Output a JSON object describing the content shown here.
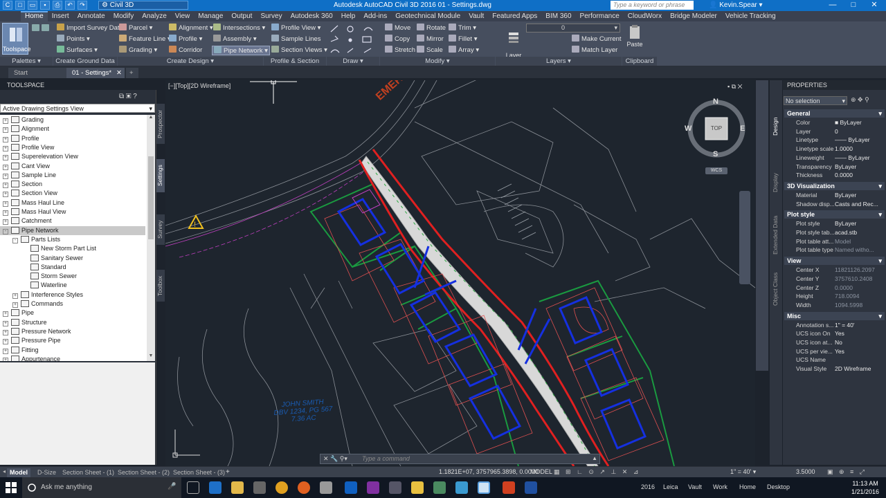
{
  "titlebar": {
    "workspace": "Civil 3D",
    "title": "Autodesk AutoCAD Civil 3D 2016   01 - Settings.dwg",
    "search_placeholder": "Type a keyword or phrase",
    "user": "Kevin.Spear"
  },
  "tabs": [
    "Home",
    "Insert",
    "Annotate",
    "Modify",
    "Analyze",
    "View",
    "Manage",
    "Output",
    "Survey",
    "Autodesk 360",
    "Help",
    "Add-ins",
    "Geotechnical Module",
    "Vault",
    "Featured Apps",
    "BIM 360",
    "Performance",
    "CloudWorx",
    "Bridge Modeler",
    "Vehicle Tracking"
  ],
  "ribbon": {
    "toolspace": "Toolspace",
    "import_survey": "Import Survey Data",
    "points": "Points",
    "surfaces": "Surfaces",
    "parcel": "Parcel",
    "feature_line": "Feature Line",
    "grading": "Grading",
    "alignment": "Alignment",
    "profile": "Profile",
    "corridor": "Corridor",
    "intersections": "Intersections",
    "assembly": "Assembly",
    "pipe_network": "Pipe Network",
    "profile_view": "Profile View",
    "sample_lines": "Sample Lines",
    "section_views": "Section Views",
    "move": "Move",
    "copy": "Copy",
    "stretch": "Stretch",
    "rotate": "Rotate",
    "mirror": "Mirror",
    "scale": "Scale",
    "trim": "Trim",
    "fillet": "Fillet",
    "array": "Array",
    "layer_properties": "Layer\nProperties",
    "layer_value": "0",
    "make_current": "Make Current",
    "match_layer": "Match Layer",
    "paste": "Paste",
    "panels": [
      "Palettes",
      "Create Ground Data",
      "Create Design",
      "Profile & Section Views",
      "Draw",
      "Modify",
      "Layers",
      "Clipboard"
    ]
  },
  "doctabs": [
    "Start",
    "01 - Settings*"
  ],
  "toolspace": {
    "title": "TOOLSPACE",
    "view": "Active Drawing Settings View",
    "tree": [
      {
        "label": "Grading",
        "level": 0,
        "exp": "+"
      },
      {
        "label": "Alignment",
        "level": 0,
        "exp": "+"
      },
      {
        "label": "Profile",
        "level": 0,
        "exp": "+"
      },
      {
        "label": "Profile View",
        "level": 0,
        "exp": "+"
      },
      {
        "label": "Superelevation View",
        "level": 0,
        "exp": "+"
      },
      {
        "label": "Cant View",
        "level": 0,
        "exp": "+"
      },
      {
        "label": "Sample Line",
        "level": 0,
        "exp": "+"
      },
      {
        "label": "Section",
        "level": 0,
        "exp": "+"
      },
      {
        "label": "Section View",
        "level": 0,
        "exp": "+"
      },
      {
        "label": "Mass Haul Line",
        "level": 0,
        "exp": "+"
      },
      {
        "label": "Mass Haul View",
        "level": 0,
        "exp": "+"
      },
      {
        "label": "Catchment",
        "level": 0,
        "exp": "+"
      },
      {
        "label": "Pipe Network",
        "level": 0,
        "exp": "-",
        "sel": true
      },
      {
        "label": "Parts Lists",
        "level": 1,
        "exp": "-"
      },
      {
        "label": "New Storm Part List",
        "level": 2,
        "exp": ""
      },
      {
        "label": "Sanitary Sewer",
        "level": 2,
        "exp": ""
      },
      {
        "label": "Standard",
        "level": 2,
        "exp": ""
      },
      {
        "label": "Storm Sewer",
        "level": 2,
        "exp": ""
      },
      {
        "label": "Waterline",
        "level": 2,
        "exp": ""
      },
      {
        "label": "Interference Styles",
        "level": 1,
        "exp": "+"
      },
      {
        "label": "Commands",
        "level": 1,
        "exp": "+"
      },
      {
        "label": "Pipe",
        "level": 0,
        "exp": "+"
      },
      {
        "label": "Structure",
        "level": 0,
        "exp": "+"
      },
      {
        "label": "Pressure Network",
        "level": 0,
        "exp": "+"
      },
      {
        "label": "Pressure Pipe",
        "level": 0,
        "exp": "+"
      },
      {
        "label": "Fitting",
        "level": 0,
        "exp": "+"
      },
      {
        "label": "Appurtenance",
        "level": 0,
        "exp": "+"
      }
    ],
    "vtabs": [
      "Prospector",
      "Settings",
      "Survey",
      "Toolbox"
    ]
  },
  "drawing": {
    "view_label": "[−][Top][2D Wireframe]",
    "street_label": "EMERS",
    "owner": [
      "JOHN SMITH",
      "DBV 1234, PG 567",
      "7.36 AC"
    ],
    "compass": {
      "n": "N",
      "s": "S",
      "e": "E",
      "w": "W",
      "top": "TOP",
      "wcs": "WCS"
    },
    "cmd_placeholder": "Type a command"
  },
  "properties": {
    "title": "PROPERTIES",
    "selection": "No selection",
    "sections": [
      {
        "name": "General",
        "rows": [
          [
            "Color",
            "■ ByLayer"
          ],
          [
            "Layer",
            "0"
          ],
          [
            "Linetype",
            "—— ByLayer"
          ],
          [
            "Linetype scale",
            "1.0000"
          ],
          [
            "Lineweight",
            "—— ByLayer"
          ],
          [
            "Transparency",
            "ByLayer"
          ],
          [
            "Thickness",
            "0.0000"
          ]
        ]
      },
      {
        "name": "3D Visualization",
        "rows": [
          [
            "Material",
            "ByLayer"
          ],
          [
            "Shadow disp...",
            "Casts and Rec..."
          ]
        ]
      },
      {
        "name": "Plot style",
        "rows": [
          [
            "Plot style",
            "ByLayer"
          ],
          [
            "Plot style tab...",
            "acad.stb"
          ],
          [
            "Plot table att...",
            "Model"
          ],
          [
            "Plot table type",
            "Named witho..."
          ]
        ]
      },
      {
        "name": "View",
        "rows": [
          [
            "Center X",
            "11821126.2097"
          ],
          [
            "Center Y",
            "3757610.2408"
          ],
          [
            "Center Z",
            "0.0000"
          ],
          [
            "Height",
            "718.0094"
          ],
          [
            "Width",
            "1094.5998"
          ]
        ]
      },
      {
        "name": "Misc",
        "rows": [
          [
            "Annotation s...",
            "1\" = 40'"
          ],
          [
            "UCS icon On",
            "Yes"
          ],
          [
            "UCS icon at...",
            "No"
          ],
          [
            "UCS per vie...",
            "Yes"
          ],
          [
            "UCS Name",
            ""
          ],
          [
            "Visual Style",
            "2D Wireframe"
          ]
        ]
      }
    ],
    "vtabs": [
      "Design",
      "Display",
      "Extended Data",
      "Object Class"
    ]
  },
  "status": {
    "layouts": [
      "Model",
      "D-Size",
      "Section Sheet - (1)",
      "Section Sheet - (2)",
      "Section Sheet - (3)"
    ],
    "coords": "1.1821E+07, 3757965.3898, 0.0000",
    "model": "MODEL",
    "scale": "1\" = 40'",
    "value": "3.5000"
  },
  "taskbar": {
    "search": "Ask me anything",
    "tray": [
      "2016",
      "Leica",
      "Vault",
      "Work",
      "Home",
      "Desktop"
    ],
    "time": "11:13 AM",
    "date": "1/21/2016"
  }
}
